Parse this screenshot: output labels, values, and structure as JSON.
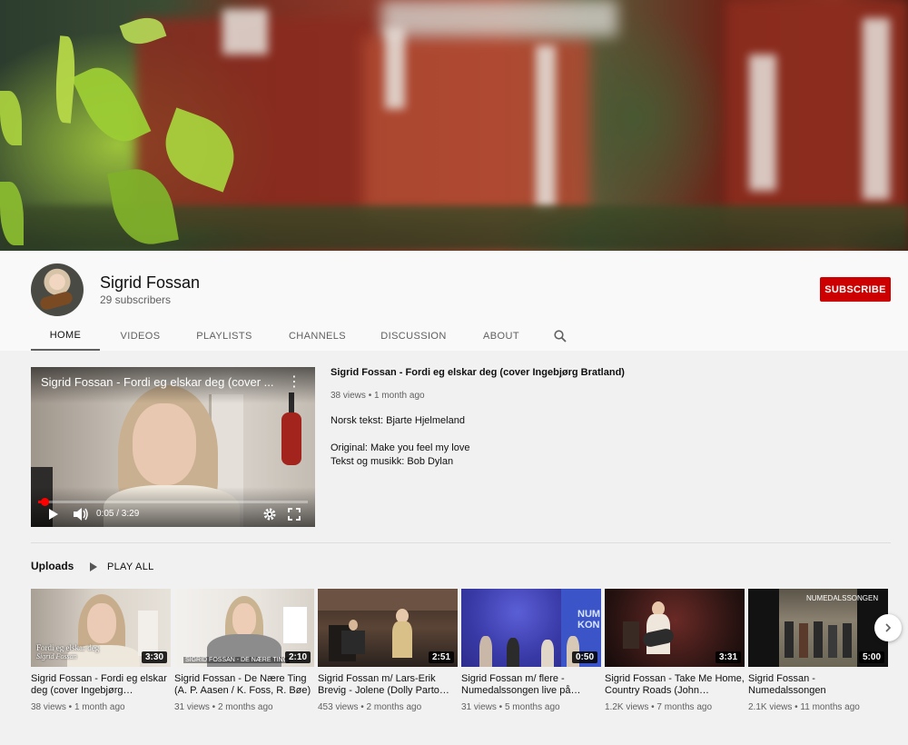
{
  "channel": {
    "name": "Sigrid Fossan",
    "subscribers": "29 subscribers",
    "subscribe_label": "SUBSCRIBE",
    "accent_color": "#cc0000"
  },
  "tabs": [
    {
      "label": "HOME",
      "active": true
    },
    {
      "label": "VIDEOS",
      "active": false
    },
    {
      "label": "PLAYLISTS",
      "active": false
    },
    {
      "label": "CHANNELS",
      "active": false
    },
    {
      "label": "DISCUSSION",
      "active": false
    },
    {
      "label": "ABOUT",
      "active": false
    }
  ],
  "featured": {
    "player_title": "Sigrid Fossan - Fordi eg elskar deg (cover ...",
    "title": "Sigrid Fossan - Fordi eg elskar deg (cover Ingebjørg Bratland)",
    "views": "38 views",
    "age": "1 month ago",
    "time": "0:05 / 3:29",
    "progress": 0.024,
    "description": [
      "Norsk tekst: Bjarte Hjelmeland",
      "",
      "Original: Make you feel my love",
      "Tekst og musikk: Bob Dylan"
    ]
  },
  "uploads": {
    "title": "Uploads",
    "play_all": "PLAY ALL",
    "videos": [
      {
        "title": "Sigrid Fossan - Fordi eg elskar deg (cover Ingebjørg…",
        "views": "38 views",
        "age": "1 month ago",
        "duration": "3:30",
        "thumb_text": [
          "Fordi eg elskar deg",
          "Sigrid Fossan"
        ]
      },
      {
        "title": "Sigrid Fossan - De Nære Ting (A. P. Aasen / K. Foss, R. Bøe)",
        "views": "31 views",
        "age": "2 months ago",
        "duration": "2:10",
        "thumb_text": "SIGRID FOSSAN - DE NÆRE TING"
      },
      {
        "title": "Sigrid Fossan m/ Lars-Erik Brevig - Jolene (Dolly Parto…",
        "views": "453 views",
        "age": "2 months ago",
        "duration": "2:51"
      },
      {
        "title": "Sigrid Fossan m/ flere - Numedalssongen live på…",
        "views": "31 views",
        "age": "5 months ago",
        "duration": "0:50",
        "thumb_text": [
          "NUM",
          "KON"
        ]
      },
      {
        "title": "Sigrid Fossan - Take Me Home, Country Roads (John…",
        "views": "1.2K views",
        "age": "7 months ago",
        "duration": "3:31"
      },
      {
        "title": "Sigrid Fossan - Numedalssongen",
        "views": "2.1K views",
        "age": "11 months ago",
        "duration": "5:00",
        "thumb_text": "NUMEDALSSONGEN"
      }
    ]
  },
  "icons": {
    "search": "search-icon",
    "play": "play-icon",
    "volume": "volume-icon",
    "settings": "gear-icon",
    "fullscreen": "fullscreen-icon",
    "menu": "more-vert-icon",
    "next": "chevron-right-icon"
  }
}
